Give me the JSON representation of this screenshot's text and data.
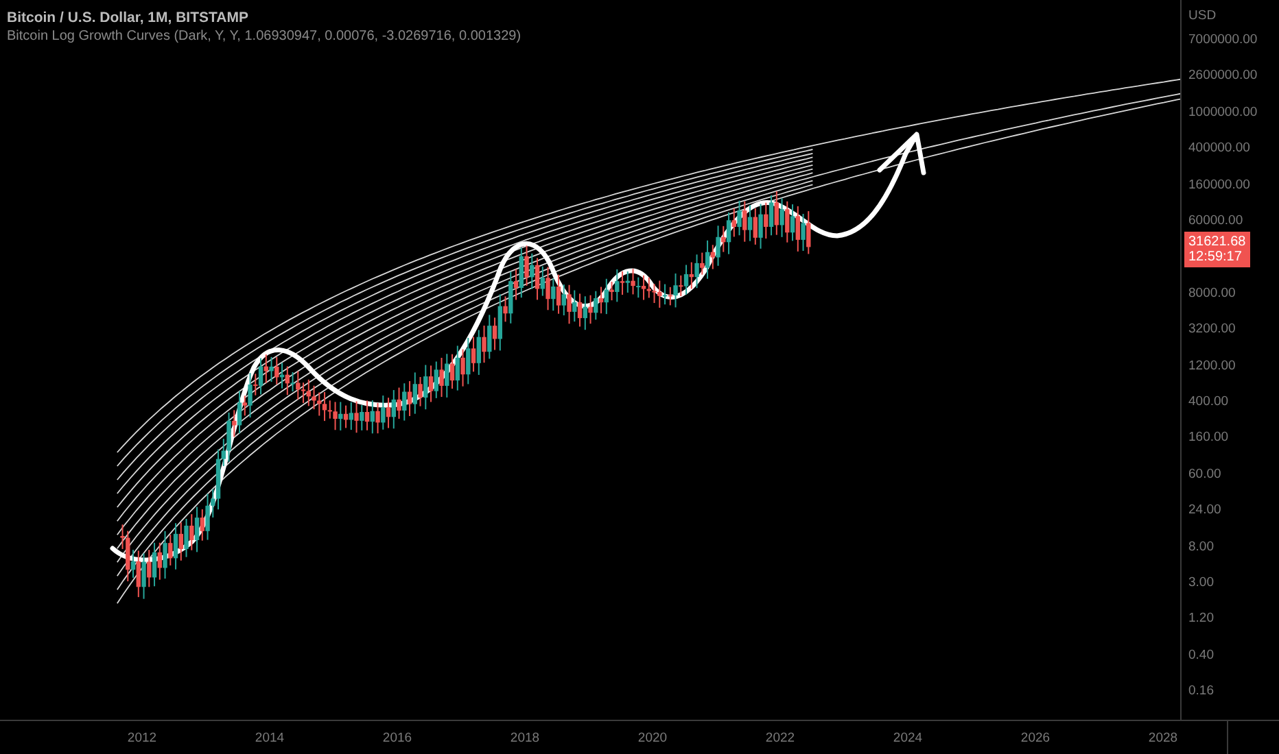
{
  "chart": {
    "title": "Bitcoin / U.S. Dollar, 1M, BITSTAMP",
    "indicator": "Bitcoin Log Growth Curves (Dark, Y, Y, 1.06930947, 0.00076, -3.0269716, 0.001329)"
  },
  "price_axis": {
    "currency": "USD",
    "labels": [
      "7000000.00",
      "2600000.00",
      "1000000.00",
      "400000.00",
      "160000.00",
      "60000.00",
      "8000.00",
      "3200.00",
      "1200.00",
      "400.00",
      "160.00",
      "60.00",
      "24.00",
      "8.00",
      "3.00",
      "1.20",
      "0.40",
      "0.16"
    ],
    "last_price": {
      "price": "31621.68",
      "countdown": "12:59:17"
    }
  },
  "time_axis": {
    "labels": [
      "2012",
      "2014",
      "2016",
      "2018",
      "2020",
      "2022",
      "2024",
      "2026",
      "2028"
    ]
  }
}
